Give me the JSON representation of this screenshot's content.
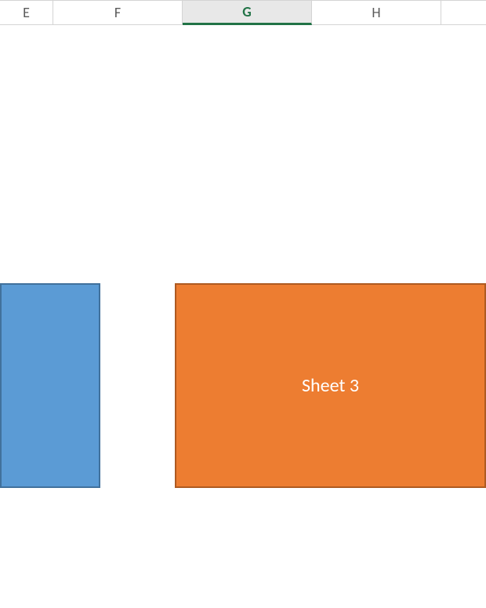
{
  "columns": {
    "e": "E",
    "f": "F",
    "g": "G",
    "h": "H",
    "i": ""
  },
  "selected_column": "G",
  "shapes": {
    "orange_label": "Sheet 3"
  },
  "colors": {
    "blue_fill": "#5b9bd5",
    "blue_border": "#41719c",
    "orange_fill": "#ed7d31",
    "orange_border": "#ae5a21",
    "excel_green": "#217346"
  }
}
